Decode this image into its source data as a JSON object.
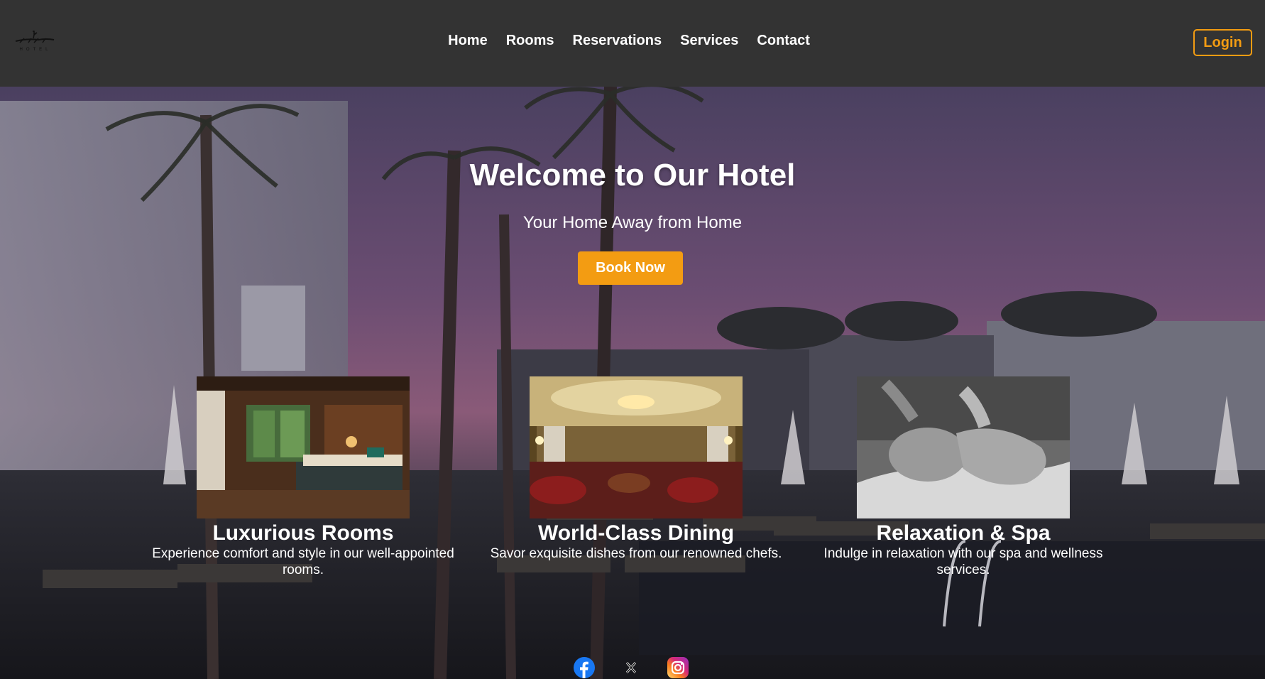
{
  "brand": {
    "logo_text": "TOKIO",
    "logo_subtext": "HOTEL"
  },
  "nav": {
    "items": [
      {
        "label": "Home"
      },
      {
        "label": "Rooms"
      },
      {
        "label": "Reservations"
      },
      {
        "label": "Services"
      },
      {
        "label": "Contact"
      }
    ],
    "login_label": "Login"
  },
  "hero": {
    "title": "Welcome to Our Hotel",
    "subtitle": "Your Home Away from Home",
    "cta_label": "Book Now"
  },
  "features": [
    {
      "title": "Luxurious Rooms",
      "description": "Experience comfort and style in our well-appointed rooms."
    },
    {
      "title": "World-Class Dining",
      "description": "Savor exquisite dishes from our renowned chefs."
    },
    {
      "title": "Relaxation & Spa",
      "description": "Indulge in relaxation with our spa and wellness services."
    }
  ],
  "social": [
    {
      "icon": "facebook-icon"
    },
    {
      "icon": "x-icon"
    },
    {
      "icon": "instagram-icon"
    }
  ],
  "colors": {
    "header_bg": "#333333",
    "accent": "#f39c12",
    "text": "#ffffff"
  }
}
